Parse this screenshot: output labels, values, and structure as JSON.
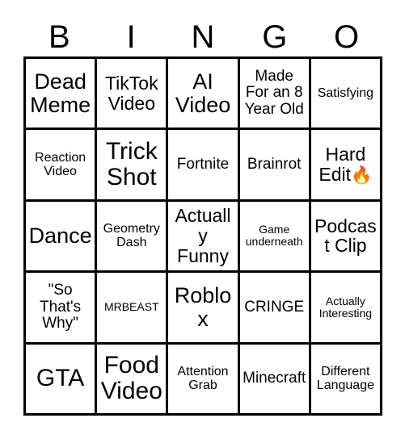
{
  "card": {
    "title": "BINGO",
    "header_letters": [
      "B",
      "I",
      "N",
      "G",
      "O"
    ],
    "grid_size": "5x5",
    "colors": {
      "background": "#ffffff",
      "border": "#000000",
      "text": "#000000",
      "emoji_accent": "#ff7a18"
    },
    "cells": [
      [
        {
          "text": "Dead Meme",
          "size": "lg"
        },
        {
          "text": "TikTok Video",
          "size": "md"
        },
        {
          "text": "AI Video",
          "size": "lg"
        },
        {
          "text": "Made For an 8 Year Old",
          "size": "sm"
        },
        {
          "text": "Satisfying",
          "size": "xs"
        }
      ],
      [
        {
          "text": "Reaction Video",
          "size": "xs"
        },
        {
          "text": "Trick Shot",
          "size": "xl"
        },
        {
          "text": "Fortnite",
          "size": "sm"
        },
        {
          "text": "Brainrot",
          "size": "sm"
        },
        {
          "text": "Hard Edit🔥",
          "size": "md"
        }
      ],
      [
        {
          "text": "Dance",
          "size": "lg"
        },
        {
          "text": "Geometry Dash",
          "size": "xs"
        },
        {
          "text": "Actually Funny",
          "size": "md"
        },
        {
          "text": "Game underneath",
          "size": "xxs"
        },
        {
          "text": "Podcast Clip",
          "size": "md"
        }
      ],
      [
        {
          "text": "\"So That's Why\"",
          "size": "sm"
        },
        {
          "text": "MRBEAST",
          "size": "xxs"
        },
        {
          "text": "Roblox",
          "size": "lg"
        },
        {
          "text": "CRINGE",
          "size": "sm"
        },
        {
          "text": "Actually Interesting",
          "size": "xxs"
        }
      ],
      [
        {
          "text": "GTA",
          "size": "xl"
        },
        {
          "text": "Food Video",
          "size": "xl"
        },
        {
          "text": "Attention Grab",
          "size": "xs"
        },
        {
          "text": "Minecraft",
          "size": "sm"
        },
        {
          "text": "Different Language",
          "size": "xs"
        }
      ]
    ]
  }
}
